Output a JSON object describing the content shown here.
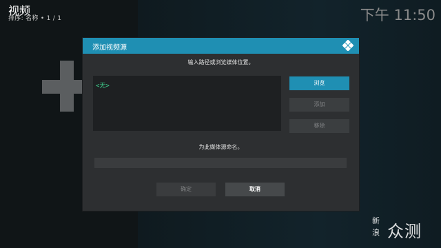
{
  "header": {
    "title": "视频",
    "sort_info": "排序: 名称 • 1 / 1",
    "clock": "下午 11:50"
  },
  "dialog": {
    "title": "添加视频源",
    "path_prompt": "输入路径或浏览媒体位置。",
    "path_list": [
      "<无>"
    ],
    "buttons": {
      "browse": "浏览",
      "add": "添加",
      "remove": "移除"
    },
    "name_prompt": "为此媒体源命名。",
    "name_value": "",
    "ok_label": "确定",
    "cancel_label": "取消"
  },
  "watermark": {
    "line1": "新",
    "line2": "浪",
    "big": "众测"
  },
  "colors": {
    "accent": "#1f8fb3",
    "dialog_bg": "#2d2f31",
    "path_text": "#3fd48f"
  }
}
